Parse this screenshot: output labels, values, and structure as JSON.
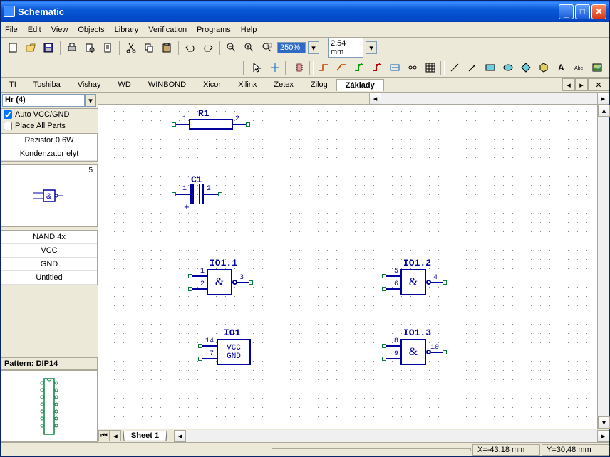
{
  "title": "Schematic",
  "window_buttons": {
    "min": "_",
    "max": "□",
    "close": "X"
  },
  "menu": [
    "File",
    "Edit",
    "View",
    "Objects",
    "Library",
    "Verification",
    "Programs",
    "Help"
  ],
  "toolbar1": {
    "zoom_value": "250%",
    "unit_value": "2,54 mm",
    "icons": [
      "new",
      "open",
      "save",
      "print",
      "print-preview",
      "page",
      "cut",
      "copy",
      "paste",
      "undo",
      "redo",
      "zoom-out",
      "zoom-in",
      "zoom-extents"
    ]
  },
  "toolbar2": {
    "icons": [
      "cursor",
      "crosshair",
      "component",
      "wire",
      "wire-angle",
      "bus",
      "bus-entry",
      "net-label",
      "net-tie",
      "junction",
      "grid",
      "line",
      "arrow",
      "rect",
      "rounded-rect",
      "ellipse",
      "polygon",
      "hexagon",
      "text",
      "abc",
      "image"
    ]
  },
  "libtabs": [
    "TI",
    "Toshiba",
    "Vishay",
    "WD",
    "WINBOND",
    "Xicor",
    "Xilinx",
    "Zetex",
    "Zilog",
    "Základy"
  ],
  "libtab_active": "Základy",
  "sidebar": {
    "selector": "Hr (4)",
    "auto_vcc_gnd": {
      "label": "Auto VCC/GND",
      "checked": true
    },
    "place_all": {
      "label": "Place All Parts",
      "checked": false
    },
    "parts": [
      "Rezistor 0,6W",
      "Kondenzator elyt"
    ],
    "preview_pin": "5",
    "partlist2": [
      "NAND 4x",
      "VCC",
      "GND",
      "Untitled"
    ],
    "pattern_label": "Pattern: DIP14"
  },
  "canvas": {
    "R1": {
      "label": "R1",
      "pins": [
        "1",
        "2"
      ]
    },
    "C1": {
      "label": "C1",
      "pins": [
        "1",
        "2"
      ],
      "plus": "+"
    },
    "IO11": {
      "label": "IO1.1",
      "sym": "&",
      "pins": [
        "1",
        "2",
        "3"
      ]
    },
    "IO12": {
      "label": "IO1.2",
      "sym": "&",
      "pins": [
        "4",
        "5",
        "6"
      ]
    },
    "IO13": {
      "label": "IO1.3",
      "sym": "&",
      "pins": [
        "8",
        "9",
        "10"
      ]
    },
    "IO1": {
      "label": "IO1",
      "vcc": "VCC",
      "gnd": "GND",
      "pins": [
        "14",
        "7"
      ]
    }
  },
  "sheet_tab": "Sheet 1",
  "status": {
    "x": "X=-43,18 mm",
    "y": "Y=30,48 mm"
  }
}
